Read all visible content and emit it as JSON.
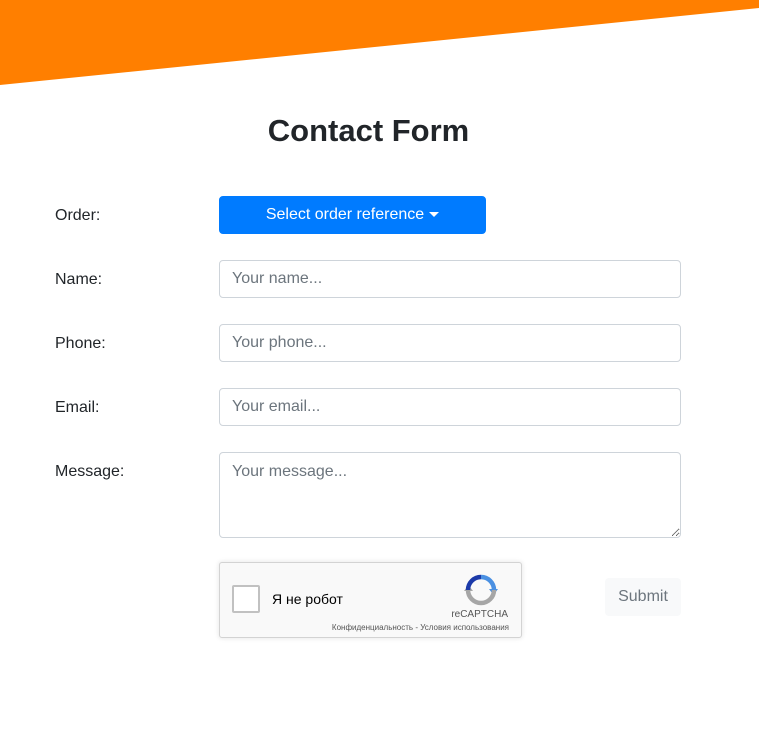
{
  "colors": {
    "banner": "#ff7f00",
    "primary": "#007bff",
    "submit_bg": "#f8f9fa",
    "submit_text": "#6c757d"
  },
  "page": {
    "title": "Contact Form"
  },
  "form": {
    "order": {
      "label": "Order:",
      "button_label": "Select order reference",
      "icon": "caret-down-icon"
    },
    "name": {
      "label": "Name:",
      "value": "",
      "placeholder": "Your name..."
    },
    "phone": {
      "label": "Phone:",
      "value": "",
      "placeholder": "Your phone..."
    },
    "email": {
      "label": "Email:",
      "value": "",
      "placeholder": "Your email..."
    },
    "message": {
      "label": "Message:",
      "value": "",
      "placeholder": "Your message..."
    },
    "submit_label": "Submit"
  },
  "recaptcha": {
    "checkbox_label": "Я не робот",
    "brand": "reCAPTCHA",
    "privacy_link": "Конфиденциальность",
    "separator": "-",
    "terms_link": "Условия использования",
    "icon": "recaptcha-logo-icon"
  }
}
